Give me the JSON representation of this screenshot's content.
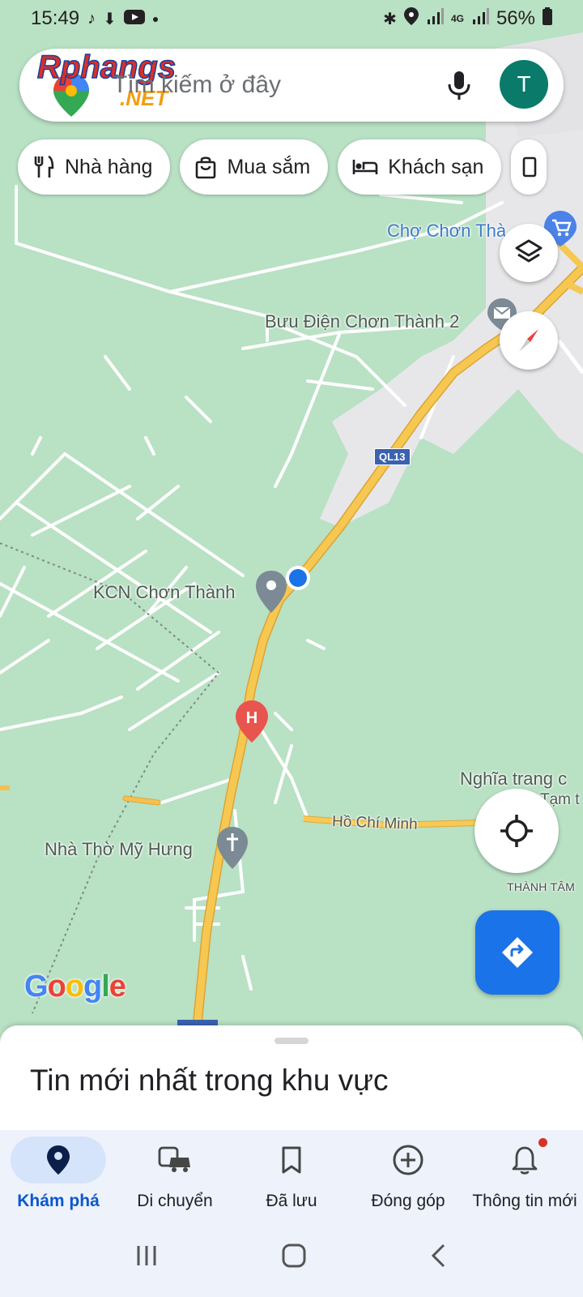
{
  "status_bar": {
    "time": "15:49",
    "network": "4G",
    "battery": "56%"
  },
  "search": {
    "placeholder": "Tìm kiếm ở đây",
    "avatar_initial": "T",
    "watermark_brand": "Rphangs",
    "watermark_tld": ".NET"
  },
  "chips": [
    {
      "label": "Nhà hàng",
      "icon": "fork-knife-icon"
    },
    {
      "label": "Mua sắm",
      "icon": "shopping-bag-icon"
    },
    {
      "label": "Khách sạn",
      "icon": "bed-icon"
    }
  ],
  "map": {
    "labels": {
      "market": "Chợ Chơn Thà",
      "post_office": "Bưu Điện Chơn Thành 2",
      "highway_shield": "QL13",
      "industrial_zone": "KCN Chơn Thành",
      "cemetery": "Nghĩa trang c",
      "cemetery_sub": "Tạm t",
      "street": "Hồ Chí Minh",
      "church": "Nhà Thờ Mỹ Hưng",
      "district": "THÀNH TÂM"
    },
    "attribution": "Google"
  },
  "sheet": {
    "title": "Tin mới nhất trong khu vực"
  },
  "bottom_nav": [
    {
      "label": "Khám phá",
      "icon": "explore-pin-icon",
      "active": true
    },
    {
      "label": "Di chuyển",
      "icon": "commute-icon",
      "active": false
    },
    {
      "label": "Đã lưu",
      "icon": "bookmark-icon",
      "active": false
    },
    {
      "label": "Đóng góp",
      "icon": "add-circle-icon",
      "active": false
    },
    {
      "label": "Thông tin mới",
      "icon": "bell-icon",
      "active": false
    }
  ],
  "colors": {
    "accent": "#1a73e8",
    "map_green": "#b9e1c4",
    "road_yellow": "#f4c04f",
    "avatar_teal": "#0a7b6a"
  }
}
